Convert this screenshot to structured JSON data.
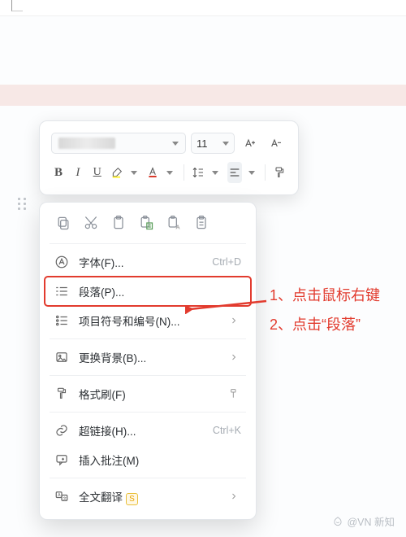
{
  "toolbar": {
    "font_size": "11",
    "bold": "B",
    "italic": "I",
    "underline": "U"
  },
  "paste_icons": [
    "copy",
    "cut",
    "paste",
    "paste-text",
    "paste-format",
    "paste-special"
  ],
  "menu": {
    "font": {
      "label": "字体(F)...",
      "shortcut": "Ctrl+D"
    },
    "paragraph": {
      "label": "段落(P)...",
      "shortcut": ""
    },
    "bullets": {
      "label": "项目符号和编号(N)...",
      "shortcut": ""
    },
    "background": {
      "label": "更换背景(B)...",
      "shortcut": ""
    },
    "format_brush": {
      "label": "格式刷(F)",
      "shortcut": ""
    },
    "hyperlink": {
      "label": "超链接(H)...",
      "shortcut": "Ctrl+K"
    },
    "comment": {
      "label": "插入批注(M)",
      "shortcut": ""
    },
    "translate": {
      "label": "全文翻译",
      "shortcut": "",
      "badge": "S"
    }
  },
  "annotations": {
    "line1": "1、点击鼠标右键",
    "line2": "2、点击“段落”"
  },
  "watermark": "@VN 新知"
}
